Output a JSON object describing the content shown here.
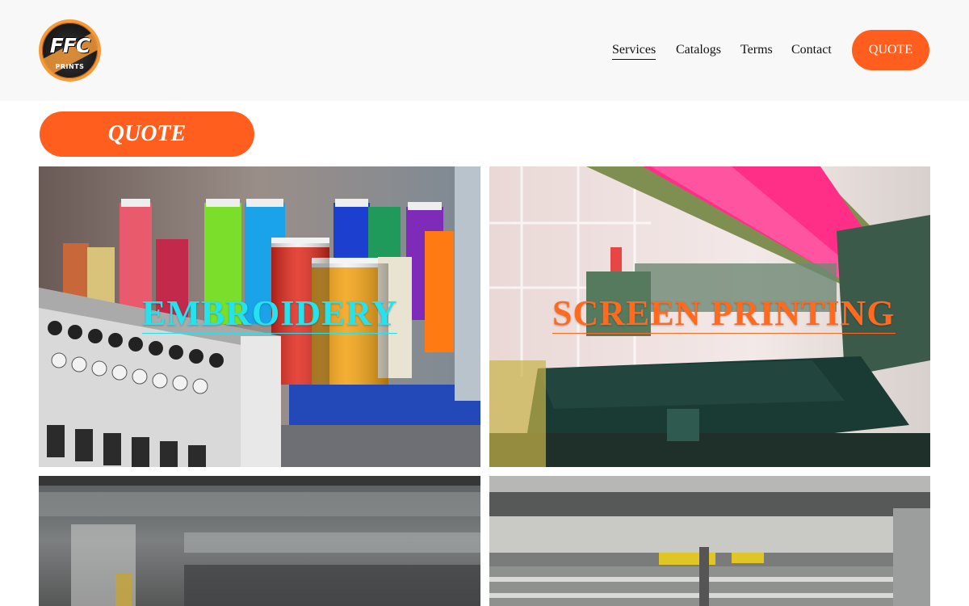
{
  "header": {
    "logo": {
      "brand_text": "FFC",
      "sub_text": "PRINTS",
      "icon": "ffc-prints-logo"
    },
    "nav": [
      {
        "label": "Services",
        "active": true
      },
      {
        "label": "Catalogs",
        "active": false
      },
      {
        "label": "Terms",
        "active": false
      },
      {
        "label": "Contact",
        "active": false
      }
    ],
    "quote_button": "QUOTE"
  },
  "main": {
    "quote_button": "QUOTE",
    "services": [
      {
        "title": "EMBROIDERY",
        "title_color": "#22e3ee",
        "image": "embroidery-thread-spools-photo"
      },
      {
        "title": "SCREEN PRINTING",
        "title_color": "#ff6a1f",
        "image": "screen-printing-press-photo"
      },
      {
        "title": "",
        "image": "blurred-machine-photo"
      },
      {
        "title": "",
        "image": "industrial-press-rollers-photo"
      }
    ]
  },
  "colors": {
    "accent": "#ff5e1f",
    "header_bg": "#f8f8f8"
  }
}
